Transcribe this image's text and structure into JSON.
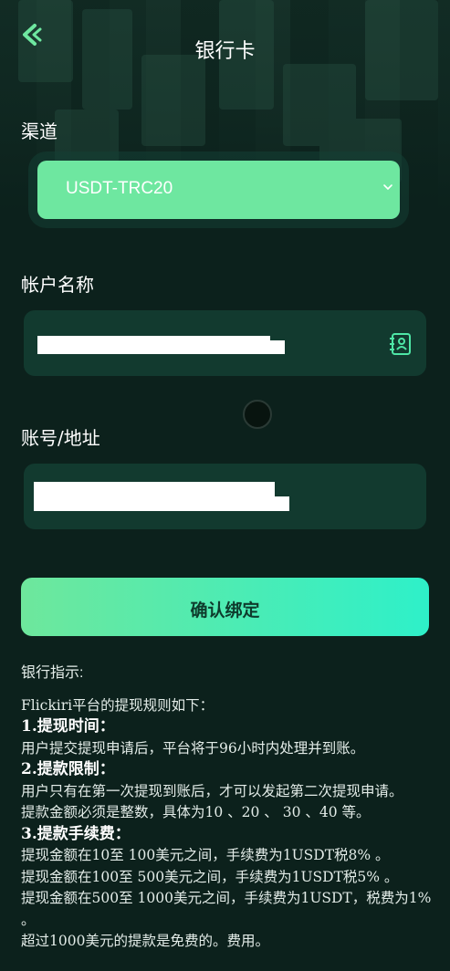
{
  "header": {
    "title": "银行卡",
    "back_icon": "chevron-left-icon"
  },
  "form": {
    "channel_label": "渠道",
    "channel_value": "USDT-TRC20",
    "account_name_label": "帐户名称",
    "account_name_value": "",
    "account_address_label": "账号/地址",
    "account_address_value": "",
    "confirm_label": "确认绑定"
  },
  "colors": {
    "background": "#0c211c",
    "accent_green": "#6ee7a0",
    "accent_teal": "#2ef0c9"
  },
  "instructions": {
    "heading": "银行指示:",
    "intro": "Flickiri平台的提现规则如下：",
    "s1_title": "1.提现时间：",
    "s1_text": "用户提交提现申请后，平台将于96小时内处理并到账。",
    "s2_title": "2.提款限制：",
    "s2_text1": "用户只有在第一次提现到账后，才可以发起第二次提现申请。",
    "s2_text2": "提款金额必须是整数，具体为10 、20 、 30 、40 等。",
    "s3_title": "3.提款手续费：",
    "s3_text1": "提现金额在10至 100美元之间，手续费为1USDT税8% 。",
    "s3_text2": "提现金额在100至 500美元之间，手续费为1USDT税5% 。",
    "s3_text3": "提现金额在500至 1000美元之间，手续费为1USDT，税费为1% 。",
    "s3_text4": "超过1000美元的提款是免费的。费用。"
  }
}
